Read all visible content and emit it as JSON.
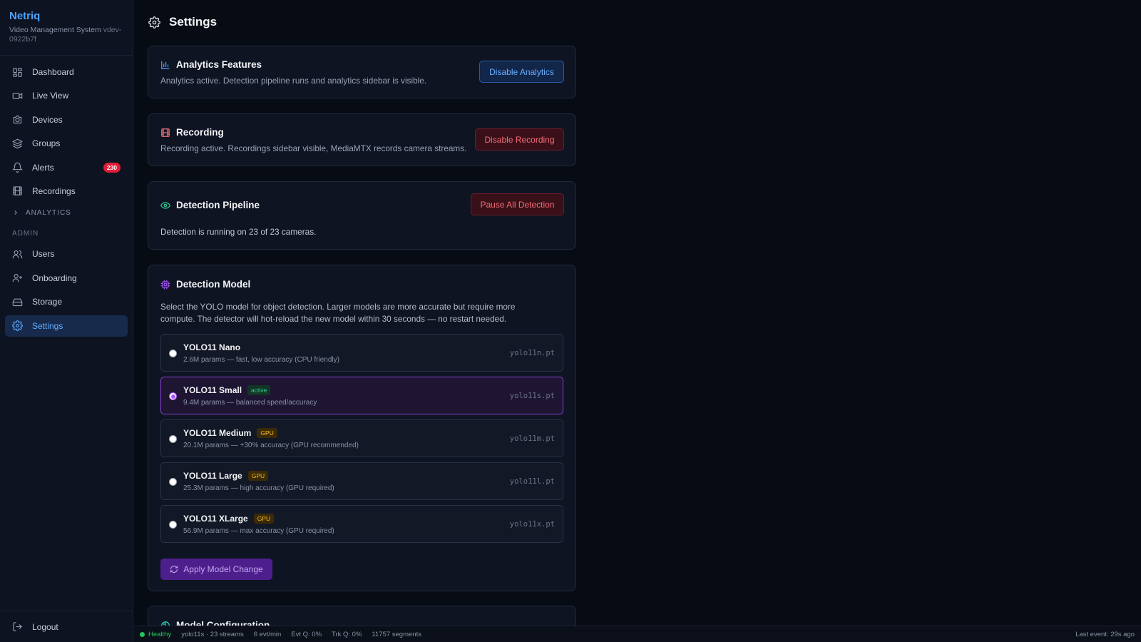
{
  "brand": {
    "name": "Netriq",
    "subtitle": "Video Management System",
    "version": "vdev-0922b7f"
  },
  "nav": {
    "items": [
      {
        "label": "Dashboard",
        "icon": "dashboard-icon"
      },
      {
        "label": "Live View",
        "icon": "video-icon"
      },
      {
        "label": "Devices",
        "icon": "camera-icon"
      },
      {
        "label": "Groups",
        "icon": "layers-icon"
      },
      {
        "label": "Alerts",
        "icon": "bell-icon",
        "badge": "230"
      },
      {
        "label": "Recordings",
        "icon": "film-icon"
      }
    ],
    "analytics_group": "ANALYTICS",
    "admin_section": "ADMIN",
    "admin_items": [
      {
        "label": "Users",
        "icon": "users-icon"
      },
      {
        "label": "Onboarding",
        "icon": "user-plus-icon"
      },
      {
        "label": "Storage",
        "icon": "hard-drive-icon"
      },
      {
        "label": "Settings",
        "icon": "gear-icon",
        "active": true
      }
    ],
    "logout": "Logout"
  },
  "page": {
    "title": "Settings"
  },
  "analytics": {
    "title": "Analytics Features",
    "desc": "Analytics active. Detection pipeline runs and analytics sidebar is visible.",
    "button": "Disable Analytics"
  },
  "recording": {
    "title": "Recording",
    "desc": "Recording active. Recordings sidebar visible, MediaMTX records camera streams.",
    "button": "Disable Recording"
  },
  "pipeline": {
    "title": "Detection Pipeline",
    "desc": "Detection is running on 23 of 23 cameras.",
    "button": "Pause All Detection"
  },
  "model": {
    "title": "Detection Model",
    "desc": "Select the YOLO model for object detection. Larger models are more accurate but require more compute. The detector will hot-reload the new model within 30 seconds — no restart needed.",
    "options": [
      {
        "name": "YOLO11 Nano",
        "desc": "2.6M params — fast, low accuracy (CPU friendly)",
        "file": "yolo11n.pt",
        "tag": ""
      },
      {
        "name": "YOLO11 Small",
        "desc": "9.4M params — balanced speed/accuracy",
        "file": "yolo11s.pt",
        "tag": "active"
      },
      {
        "name": "YOLO11 Medium",
        "desc": "20.1M params — +30% accuracy (GPU recommended)",
        "file": "yolo11m.pt",
        "tag": "GPU"
      },
      {
        "name": "YOLO11 Large",
        "desc": "25.3M params — high accuracy (GPU required)",
        "file": "yolo11l.pt",
        "tag": "GPU"
      },
      {
        "name": "YOLO11 XLarge",
        "desc": "56.9M params — max accuracy (GPU required)",
        "file": "yolo11x.pt",
        "tag": "GPU"
      }
    ],
    "selected": 1,
    "apply": "Apply Model Change"
  },
  "model_config": {
    "title": "Model Configuration"
  },
  "status": {
    "health": "Healthy",
    "model": "yolo11s · 23 streams",
    "rate": "6 evt/min",
    "evt_q": "Evt Q: 0%",
    "trk_q": "Trk Q: 0%",
    "segments": "11757 segments",
    "last_event": "Last event: 29s ago"
  },
  "colors": {
    "accent": "#4da3ff",
    "danger": "#f36b78",
    "purple": "#a855f7",
    "success": "#22c55e"
  }
}
